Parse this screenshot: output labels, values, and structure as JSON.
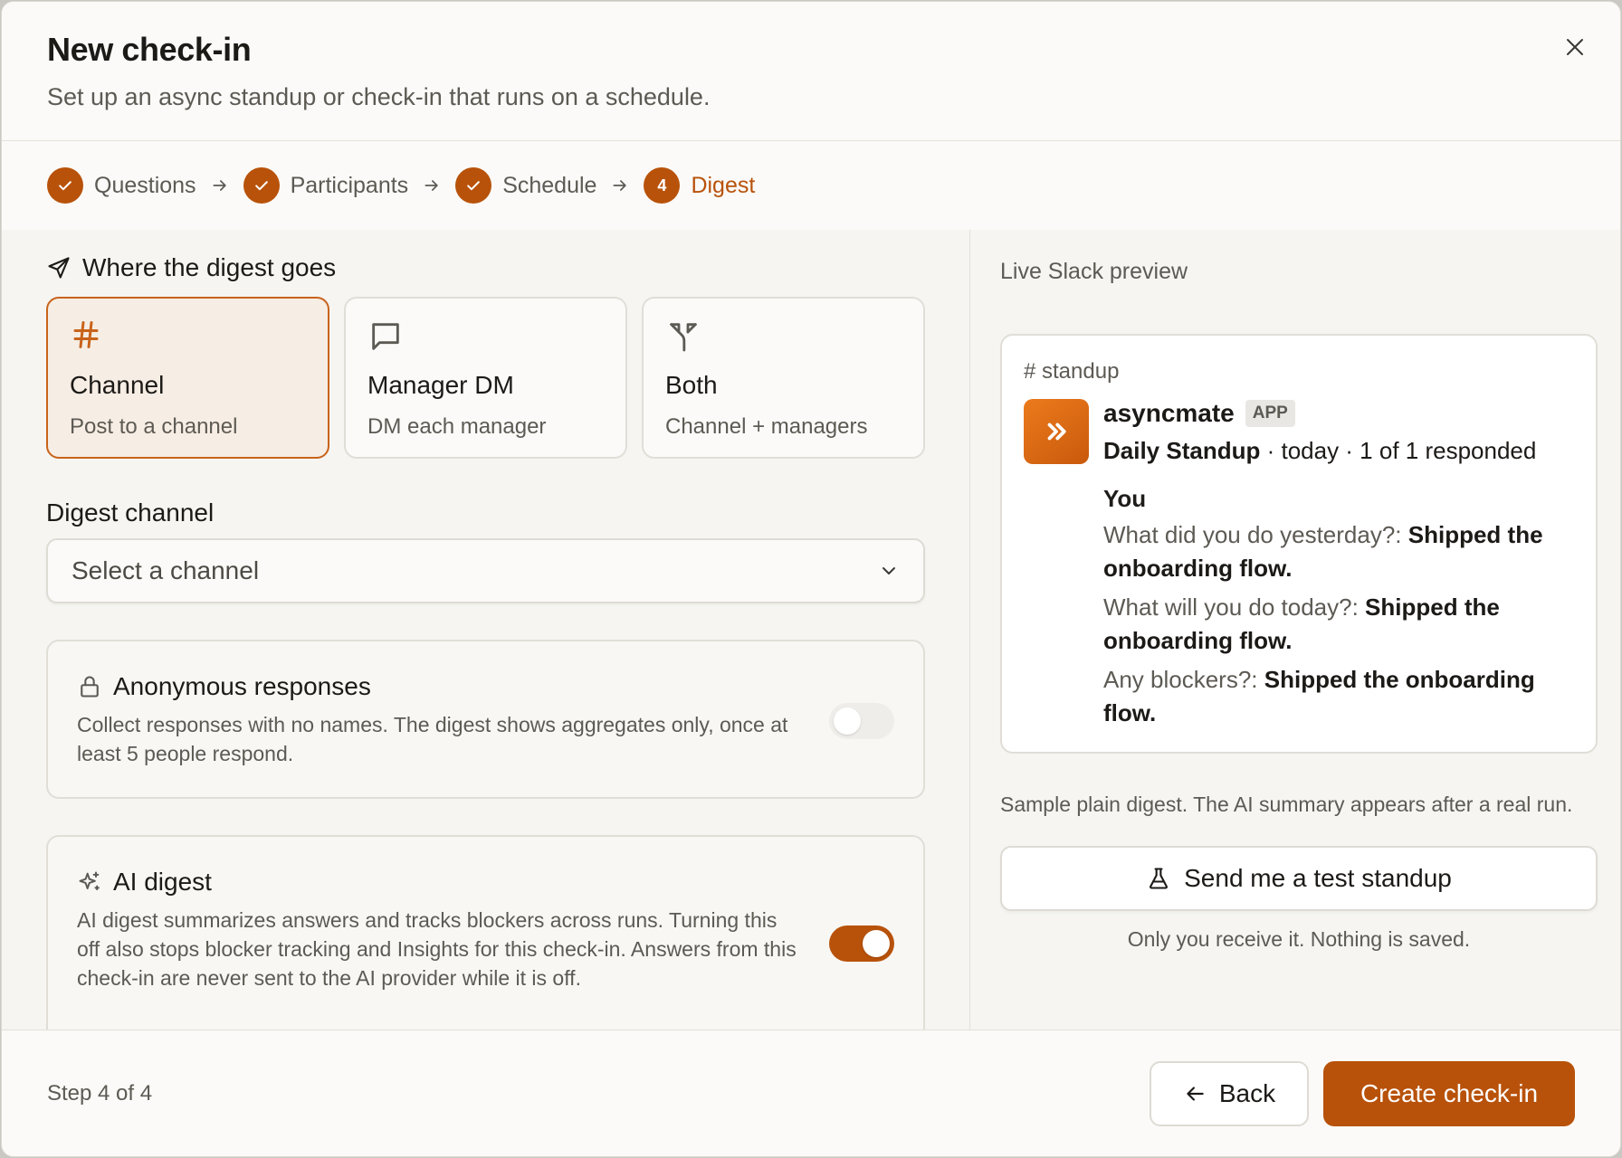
{
  "header": {
    "title": "New check-in",
    "subtitle": "Set up an async standup or check-in that runs on a schedule."
  },
  "stepper": {
    "steps": [
      {
        "label": "Questions",
        "state": "done"
      },
      {
        "label": "Participants",
        "state": "done"
      },
      {
        "label": "Schedule",
        "state": "done"
      },
      {
        "label": "Digest",
        "state": "active",
        "number": "4"
      }
    ]
  },
  "destination": {
    "title": "Where the digest goes",
    "options": [
      {
        "name": "Channel",
        "desc": "Post to a channel",
        "icon": "hash-icon",
        "selected": true
      },
      {
        "name": "Manager DM",
        "desc": "DM each manager",
        "icon": "message-square-icon",
        "selected": false
      },
      {
        "name": "Both",
        "desc": "Channel + managers",
        "icon": "split-icon",
        "selected": false
      }
    ]
  },
  "digest_channel": {
    "label": "Digest channel",
    "placeholder": "Select a channel"
  },
  "anonymous": {
    "title": "Anonymous responses",
    "desc": "Collect responses with no names. The digest shows aggregates only, once at least 5 people respond.",
    "enabled": false
  },
  "ai_digest": {
    "title": "AI digest",
    "desc": "AI digest summarizes answers and tracks blockers across runs. Turning this off also stops blocker tracking and Insights for this check-in. Answers from this check-in are never sent to the AI provider while it is off.",
    "enabled": true
  },
  "preview": {
    "label": "Live Slack preview",
    "channel": "# standup",
    "app_name": "asyncmate",
    "app_badge": "APP",
    "checkin_name": "Daily Standup",
    "meta": " · today · 1 of 1 responded",
    "respondent": "You",
    "qa": [
      {
        "q": "What did you do yesterday?:",
        "a": "Shipped the onboarding flow."
      },
      {
        "q": "What will you do today?:",
        "a": "Shipped the onboarding flow."
      },
      {
        "q": "Any blockers?:",
        "a": "Shipped the onboarding flow."
      }
    ],
    "note": "Sample plain digest. The AI summary appears after a real run.",
    "test_button": "Send me a test standup",
    "test_note": "Only you receive it. Nothing is saved."
  },
  "footer": {
    "step_count": "Step 4 of 4",
    "back": "Back",
    "create": "Create check-in"
  },
  "colors": {
    "accent": "#b8520a",
    "selected_bg": "#f6ede4",
    "muted_text": "#5d5a54"
  }
}
